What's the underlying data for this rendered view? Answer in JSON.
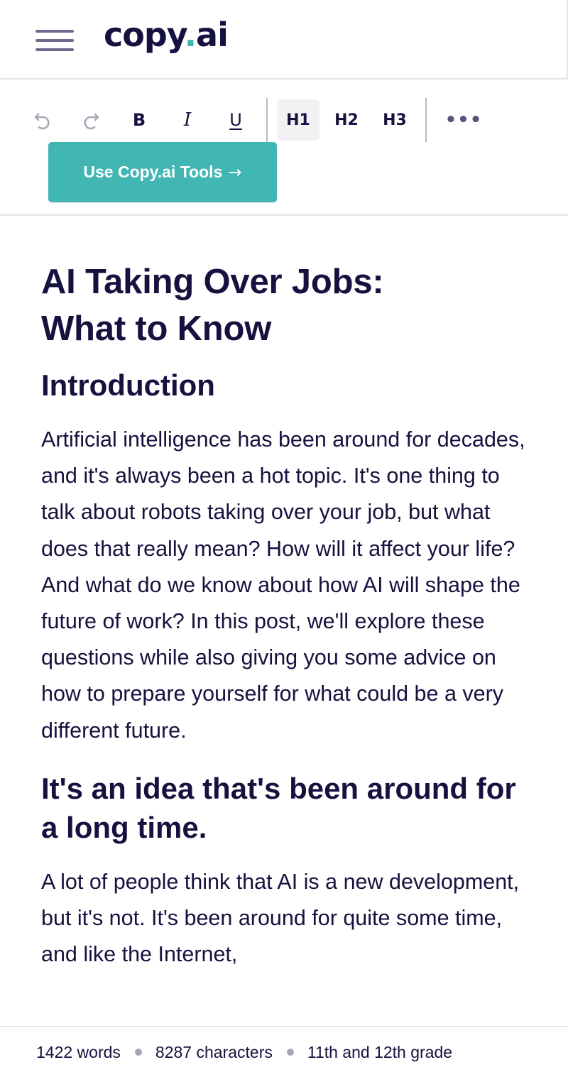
{
  "header": {
    "logo_text_before": "copy",
    "logo_dot": ".",
    "logo_text_after": "ai",
    "menu_icon": "hamburger-menu-icon"
  },
  "toolbar": {
    "undo_icon": "↶",
    "redo_icon": "↷",
    "bold_label": "B",
    "italic_label": "I",
    "underline_label": "U",
    "h1_label": "H1",
    "h2_label": "H2",
    "h3_label": "H3",
    "more_label": "•••",
    "cta_label": "Use Copy.ai Tools",
    "cta_arrow": "→",
    "active_heading": "H1"
  },
  "document": {
    "title_line1": "AI Taking Over Jobs:",
    "title_line2": "What to Know",
    "section1_heading": "Introduction",
    "section1_body": "Artificial intelligence has been around for decades, and it's always been a hot topic. It's one thing to talk about robots taking over your job, but what does that really mean? How will it affect your life? And what do we know about how AI will shape the future of work? In this post, we'll explore these questions while also giving you some advice on how to prepare yourself for what could be a very different future.",
    "section2_heading": "It's an idea that's been around for a long time.",
    "section2_body": "A lot of people think that AI is a new development, but it's not. It's been around for quite some time, and like the Internet,"
  },
  "footer": {
    "words": "1422 words",
    "characters": "8287 characters",
    "grade": "11th and 12th grade"
  },
  "colors": {
    "brand_teal": "#41b6b3",
    "text_navy": "#16123f",
    "divider": "#e4e4ea"
  }
}
